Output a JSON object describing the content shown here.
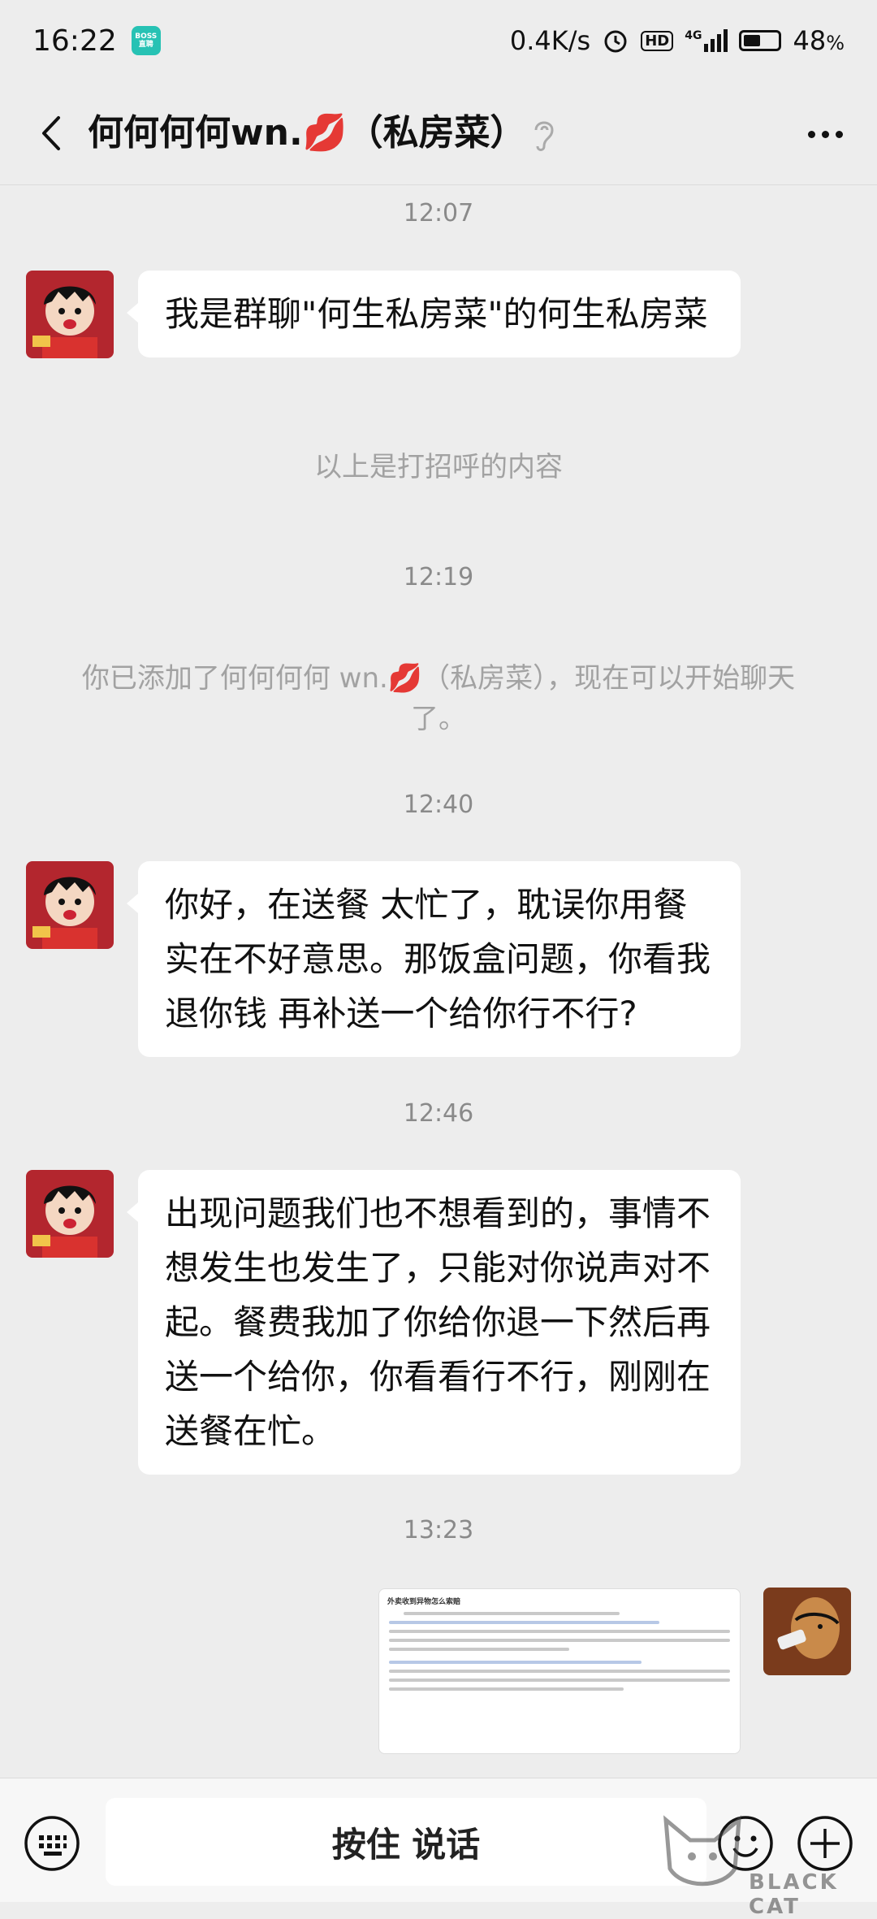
{
  "status_bar": {
    "time": "16:22",
    "boss_app": {
      "line1": "BOSS",
      "line2": "直聘"
    },
    "net_speed": "0.4K/s",
    "hd": "HD",
    "signal": "4G",
    "battery": "48",
    "battery_unit": "%",
    "battery_level": 0.48
  },
  "header": {
    "title": "何何何何wn.💋（私房菜）"
  },
  "messages": {
    "time_1": "12:07",
    "msg_1": "我是群聊\"何生私房菜\"的何生私房菜",
    "sys_1": "以上是打招呼的内容",
    "time_2": "12:19",
    "sys_2": "你已添加了何何何何 wn.💋（私房菜），现在可以开始聊天了。",
    "time_3": "12:40",
    "msg_2": "你好，在送餐 太忙了，耽误你用餐实在不好意思。那饭盒问题，你看我退你钱 再补送一个给你行不行?",
    "time_4": "12:46",
    "msg_3": "出现问题我们也不想看到的，事情不想发生也发生了，只能对你说声对不起。餐费我加了你给你退一下然后再送一个给你，你看看行不行，刚刚在送餐在忙。",
    "time_5": "13:23",
    "image_doc_title": "外卖收到异物怎么索赔"
  },
  "input": {
    "voice_label": "按住 说话"
  },
  "watermark": {
    "text": "BLACK CAT"
  },
  "icons": [
    "back-icon",
    "ear-icon",
    "more-icon",
    "keyboard-icon",
    "emoji-icon",
    "plus-icon",
    "alarm-icon",
    "battery-icon",
    "signal-icon"
  ]
}
